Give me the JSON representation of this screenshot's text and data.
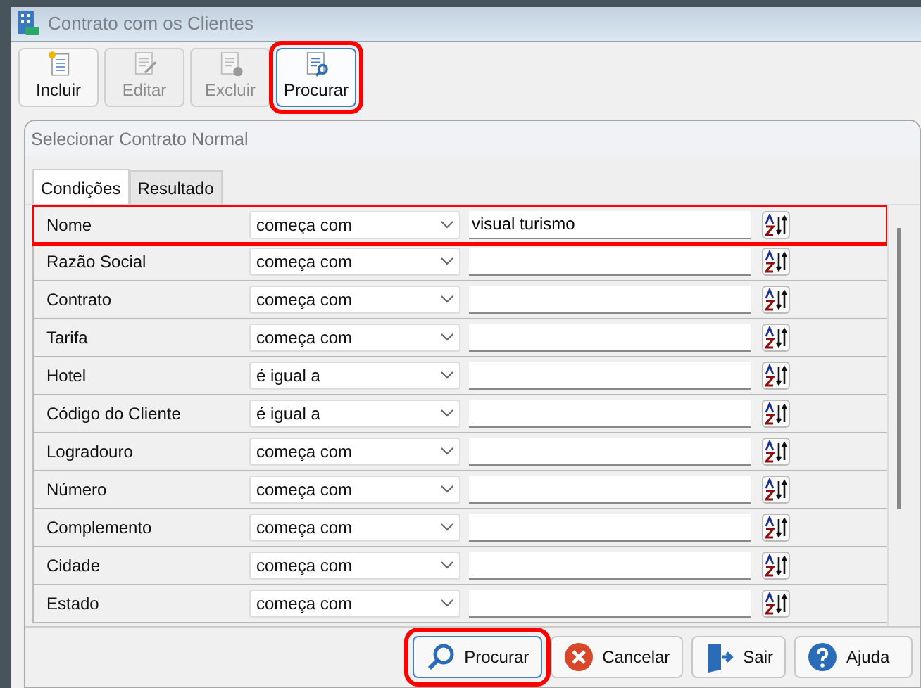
{
  "window": {
    "title": "Contrato com os Clientes"
  },
  "toolbar": [
    {
      "label": "Incluir",
      "kind": "add",
      "disabled": false,
      "selected": false,
      "highlighted": false
    },
    {
      "label": "Editar",
      "kind": "edit",
      "disabled": true,
      "selected": false,
      "highlighted": false
    },
    {
      "label": "Excluir",
      "kind": "delete",
      "disabled": true,
      "selected": false,
      "highlighted": false
    },
    {
      "label": "Procurar",
      "kind": "search",
      "disabled": false,
      "selected": true,
      "highlighted": true
    }
  ],
  "dialog": {
    "title": "Selecionar Contrato Normal",
    "tabs": [
      {
        "label": "Condições",
        "selected": true
      },
      {
        "label": "Resultado",
        "selected": false
      }
    ],
    "conditions": [
      {
        "field": "Nome",
        "operator": "começa com",
        "value": "visual turismo",
        "highlighted": true
      },
      {
        "field": "Razão Social",
        "operator": "começa com",
        "highlighted": false
      },
      {
        "field": "Contrato",
        "operator": "começa com",
        "highlighted": false
      },
      {
        "field": "Tarifa",
        "operator": "começa com",
        "highlighted": false
      },
      {
        "field": "Hotel",
        "operator": "é igual a",
        "highlighted": false
      },
      {
        "field": "Código do Cliente",
        "operator": "é igual a",
        "highlighted": false
      },
      {
        "field": "Logradouro",
        "operator": "começa com",
        "highlighted": false
      },
      {
        "field": "Número",
        "operator": "começa com",
        "highlighted": false
      },
      {
        "field": "Complemento",
        "operator": "começa com",
        "highlighted": false
      },
      {
        "field": "Cidade",
        "operator": "começa com",
        "highlighted": false
      },
      {
        "field": "Estado",
        "operator": "começa com",
        "highlighted": false
      }
    ],
    "buttons": [
      {
        "label": "Procurar",
        "kind": "search",
        "highlighted": true
      },
      {
        "label": "Cancelar",
        "kind": "cancel",
        "highlighted": false
      },
      {
        "label": "Sair",
        "kind": "exit",
        "highlighted": false
      },
      {
        "label": "Ajuda",
        "kind": "help",
        "highlighted": false
      }
    ]
  }
}
